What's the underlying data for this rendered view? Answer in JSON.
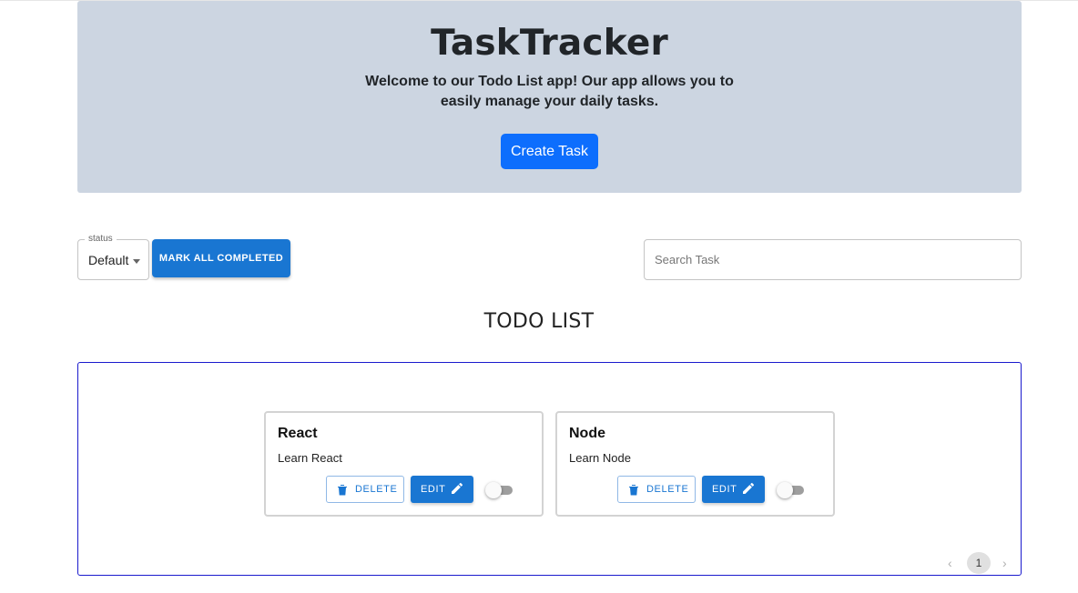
{
  "hero": {
    "title": "TaskTracker",
    "lead": "Welcome to our Todo List app! Our app allows you to easily manage your daily tasks.",
    "create_label": "Create Task"
  },
  "filters": {
    "status_label": "status",
    "status_value": "Default",
    "mark_all_label": "MARK ALL COMPLETED",
    "search_placeholder": "Search Task"
  },
  "list": {
    "heading": "TODO LIST",
    "cards": [
      {
        "title": "React",
        "description": "Learn React",
        "delete_label": "DELETE",
        "edit_label": "EDIT",
        "completed": false
      },
      {
        "title": "Node",
        "description": "Learn Node",
        "delete_label": "DELETE",
        "edit_label": "EDIT",
        "completed": false
      }
    ],
    "pagination": {
      "current_page": "1"
    }
  },
  "colors": {
    "hero_bg": "#ccd5e1",
    "primary": "#0d6efd",
    "mui_primary": "#1976d2",
    "list_border": "#1a1acd"
  },
  "icons": {
    "delete": "trash-icon",
    "edit": "pencil-icon",
    "prev": "chevron-left-icon",
    "next": "chevron-right-icon",
    "dropdown": "caret-down-icon"
  }
}
